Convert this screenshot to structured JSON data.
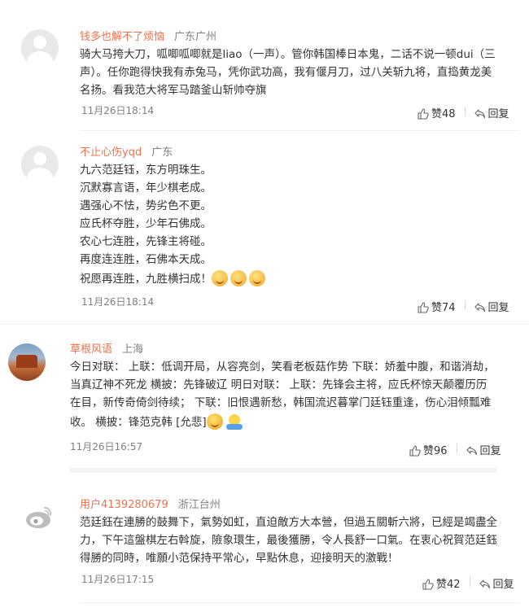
{
  "comments": [
    {
      "username": "钱多也解不了烦恼",
      "location": "广东广州",
      "avatar": "default-avatar",
      "lines": [
        "骑大马挎大刀，呱唧呱唧就是liao（一声）。管你韩国棒日本鬼，二话不说一顿dui（三",
        "声）。任你跑得快我有赤兔马，凭你武功高，我有偃月刀，过八关斩九将，直捣黄龙美",
        "名扬。看我范大将军马踏釜山斩帅夺旗"
      ],
      "time": "11月26日18:14",
      "like_label": "赞48",
      "reply_label": "回复"
    },
    {
      "username": "不止心伤yqd",
      "location": "广东",
      "avatar": "default-avatar",
      "lines": [
        "九六范廷钰，东方明珠生。",
        "沉默寡言语，年少棋老成。",
        "遇强心不怯，势劣色不更。",
        "应氏杯夺胜，少年石佛成。",
        "农心七连胜，先锋主将碰。",
        "再度连连胜，石佛本天成。",
        "祝愿再连胜，九胜横扫成！"
      ],
      "emojis": [
        "shy-emoji",
        "shy-emoji",
        "shy-emoji"
      ],
      "time": "11月26日18:14",
      "like_label": "赞74",
      "reply_label": "回复"
    },
    {
      "username": "草根风语",
      "location": "上海",
      "avatar": "desert-rock-avatar",
      "lines": [
        "今日对联： 上联：低调开局，从容亮剑，笑看老板菇作势 下联：娇羞中腹，和谐消劫，",
        "当真辽神不死龙 横披：先锋破辽 明日对联： 上联：先锋会主将，应氏杯惊天颠覆历历",
        "在目，新传奇倚剑待续； 下联：旧恨遇新愁，韩国流迟暮掌门廷钰重逢，伤心泪倾瓢难",
        "收。 横披：锋范克韩 [允悲]"
      ],
      "emojis": [
        "thinking-emoji",
        "hug-emoji"
      ],
      "time": "11月26日16:57",
      "like_label": "赞96",
      "reply_label": "回复"
    },
    {
      "username": "用户4139280679",
      "location": "浙江台州",
      "avatar": "weibo-default-avatar",
      "lines": [
        "范廷鈺在連勝的鼓舞下，氣勢如虹，直迫敵方大本營，但過五關斬六將，已經是竭盡全",
        "力，下午這盤棋左右斡旋，險象環生，最後獲勝，令人長舒一口氣。在衷心祝賀范廷鈺",
        "得勝的同時，唯願小范保持平常心，早點休息，迎接明天的激戰！"
      ],
      "time": "11月26日17:15",
      "like_label": "赞42",
      "reply_label": "回复"
    }
  ],
  "colors": {
    "username": "#eb7350",
    "meta": "#808080",
    "text": "#333333"
  }
}
